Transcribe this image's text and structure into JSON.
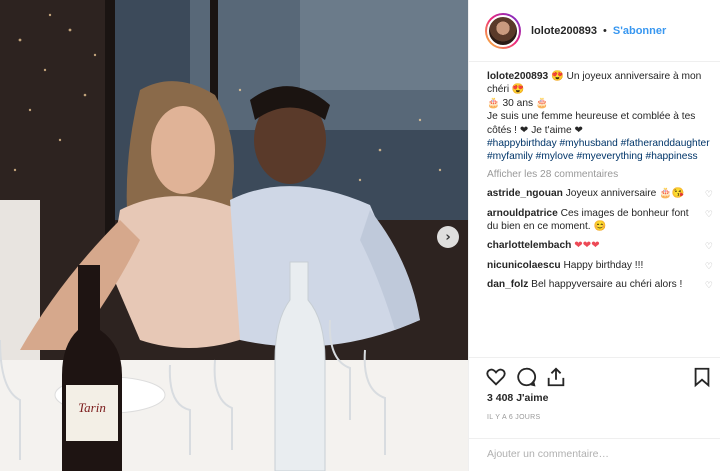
{
  "post": {
    "username": "lolote200893",
    "separator": "•",
    "follow_label": "S'abonner"
  },
  "caption": {
    "username": "lolote200893",
    "line1": "😍 Un joyeux anniversaire à mon chéri 😍",
    "line2": "🎂 30 ans 🎂",
    "line3": "Je suis une femme heureuse et comblée à tes côtés ! ❤ Je t'aime ❤",
    "hashtags": "#happybirthday #myhusband #fatheranddaughter #myfamily #mylove #myeverything #happiness"
  },
  "view_all_label": "Afficher les 28 commentaires",
  "comments": [
    {
      "username": "astride_ngouan",
      "text": "Joyeux anniversaire 🎂😘"
    },
    {
      "username": "arnouldpatrice",
      "text": "Ces images de bonheur font du bien en ce moment. 😊"
    },
    {
      "username": "charlottelembach",
      "text": "❤❤❤"
    },
    {
      "username": "nicunicolaescu",
      "text": "Happy birthday !!!"
    },
    {
      "username": "dan_folz",
      "text": "Bel happyversaire au chéri alors !"
    }
  ],
  "likes_label": "3 408 J'aime",
  "date_label": "IL Y A 6 JOURS",
  "add_comment_placeholder": "Ajouter un commentaire…",
  "photo": {
    "wine_label": "Tarin",
    "next_icon": "›"
  },
  "icons": {
    "like": "heart-icon",
    "comment": "comment-icon",
    "share": "share-icon",
    "save": "bookmark-icon",
    "comment_like": "♡"
  }
}
